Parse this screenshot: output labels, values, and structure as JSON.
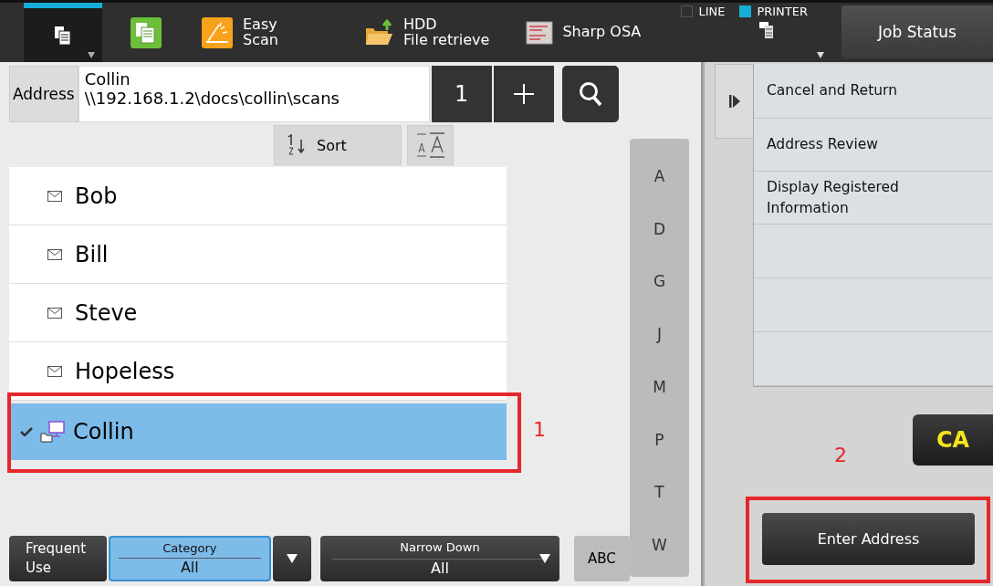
{
  "top_bar": {
    "modes": [
      {
        "kind": "home",
        "selected": true
      },
      {
        "kind": "copy",
        "selected": false
      },
      {
        "kind": "easy-scan",
        "label_lines": [
          "Easy",
          "Scan"
        ],
        "selected": false
      },
      {
        "kind": "hdd",
        "label_lines": [
          "HDD",
          "File retrieve"
        ],
        "selected": false
      },
      {
        "kind": "osa",
        "label_lines": [
          "Sharp OSA"
        ],
        "selected": false
      }
    ],
    "indicators": [
      {
        "label": "LINE",
        "on": false
      },
      {
        "label": "PRINTER",
        "on": true
      }
    ],
    "job_status": "Job Status"
  },
  "address": {
    "label": "Address",
    "value_lines": [
      "Collin",
      "\\\\192.168.1.2\\docs\\collin\\scans"
    ],
    "count": "1"
  },
  "sort": {
    "label": "Sort"
  },
  "entries": [
    {
      "name": "Bob",
      "kind": "email",
      "selected": false
    },
    {
      "name": "Bill",
      "kind": "email",
      "selected": false
    },
    {
      "name": "Steve",
      "kind": "email",
      "selected": false
    },
    {
      "name": "Hopeless",
      "kind": "email",
      "selected": false
    },
    {
      "name": "Collin",
      "kind": "folder",
      "selected": true
    }
  ],
  "index_letters": [
    "A",
    "D",
    "G",
    "J",
    "M",
    "P",
    "T",
    "W"
  ],
  "bottom_bar": {
    "frequent_use": "Frequent Use",
    "filters": [
      {
        "label": "Category",
        "value": "All",
        "selected": true
      },
      {
        "label": "Narrow Down",
        "value": "All",
        "selected": false
      }
    ],
    "abc": "ABC"
  },
  "side_menu": {
    "items": [
      "Cancel and Return",
      "Address Review",
      "Display Registered Information"
    ],
    "ca": "CA",
    "enter_address": "Enter Address"
  },
  "annotations": [
    {
      "label": "1"
    },
    {
      "label": "2"
    }
  ]
}
